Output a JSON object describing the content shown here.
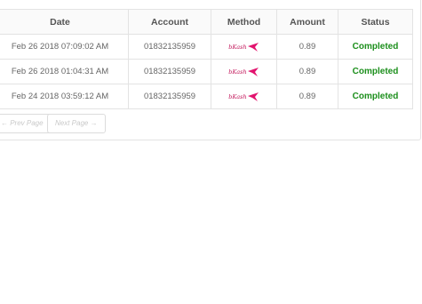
{
  "table": {
    "headers": [
      "Date",
      "Account",
      "Method",
      "Amount",
      "Status"
    ],
    "rows": [
      {
        "date": "Feb 26 2018 07:09:02 AM",
        "account": "01832135959",
        "method": "bKash",
        "amount": "0.89",
        "status": "Completed"
      },
      {
        "date": "Feb 26 2018 01:04:31 AM",
        "account": "01832135959",
        "method": "bKash",
        "amount": "0.89",
        "status": "Completed"
      },
      {
        "date": "Feb 24 2018 03:59:12 AM",
        "account": "01832135959",
        "method": "bKash",
        "amount": "0.89",
        "status": "Completed"
      }
    ]
  },
  "pagination": {
    "prev_label": "← Prev Page",
    "next_label": "Next Page →"
  },
  "colors": {
    "status_completed": "#1c8f1c",
    "bkash_brand": "#e2136e"
  }
}
